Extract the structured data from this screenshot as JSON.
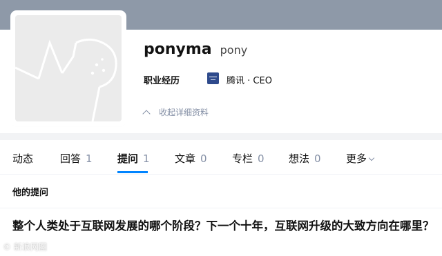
{
  "profile": {
    "name": "ponyma",
    "headline": "pony",
    "info_label": "职业经历",
    "company": "腾讯 · CEO",
    "collapse_label": "收起详细资料"
  },
  "tabs": [
    {
      "label": "动态",
      "count": ""
    },
    {
      "label": "回答",
      "count": "1"
    },
    {
      "label": "提问",
      "count": "1"
    },
    {
      "label": "文章",
      "count": "0"
    },
    {
      "label": "专栏",
      "count": "0"
    },
    {
      "label": "想法",
      "count": "0"
    },
    {
      "label": "更多",
      "count": ""
    }
  ],
  "active_tab": "提问",
  "section": {
    "title": "他的提问"
  },
  "questions": [
    {
      "title": "整个人类处于互联网发展的哪个阶段？下一个十年，互联网升级的大致方向在哪里？"
    }
  ],
  "watermark": "© 新浪网图",
  "colors": {
    "accent": "#0084ff",
    "cover": "#8e99a8",
    "muted": "#8590a6"
  }
}
